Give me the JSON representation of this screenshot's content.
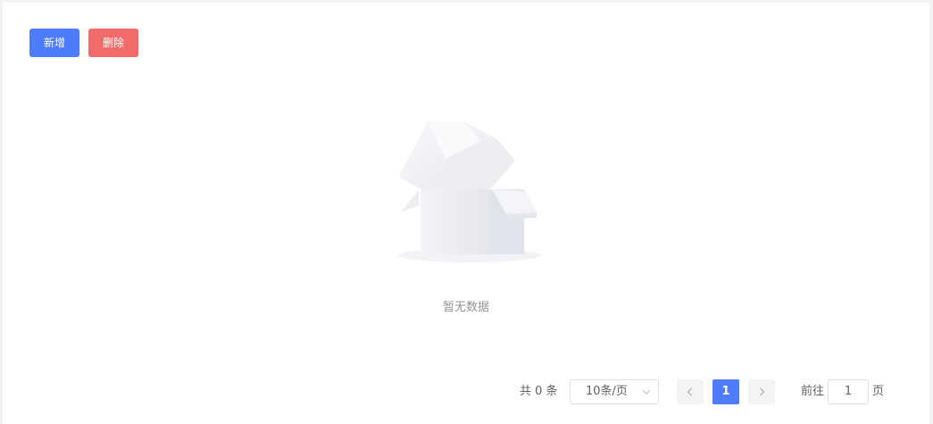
{
  "toolbar": {
    "add_label": "新增",
    "delete_label": "删除",
    "add_color": "#4f7cff",
    "delete_color": "#f26b6b"
  },
  "empty": {
    "icon": "empty-box-icon",
    "text": "暂无数据"
  },
  "pagination": {
    "total_text": "共 0 条",
    "page_size": "10条/页",
    "current_page": "1",
    "goto_prefix": "前往",
    "goto_value": "1",
    "goto_suffix": "页",
    "accent": "#4f7cff"
  }
}
